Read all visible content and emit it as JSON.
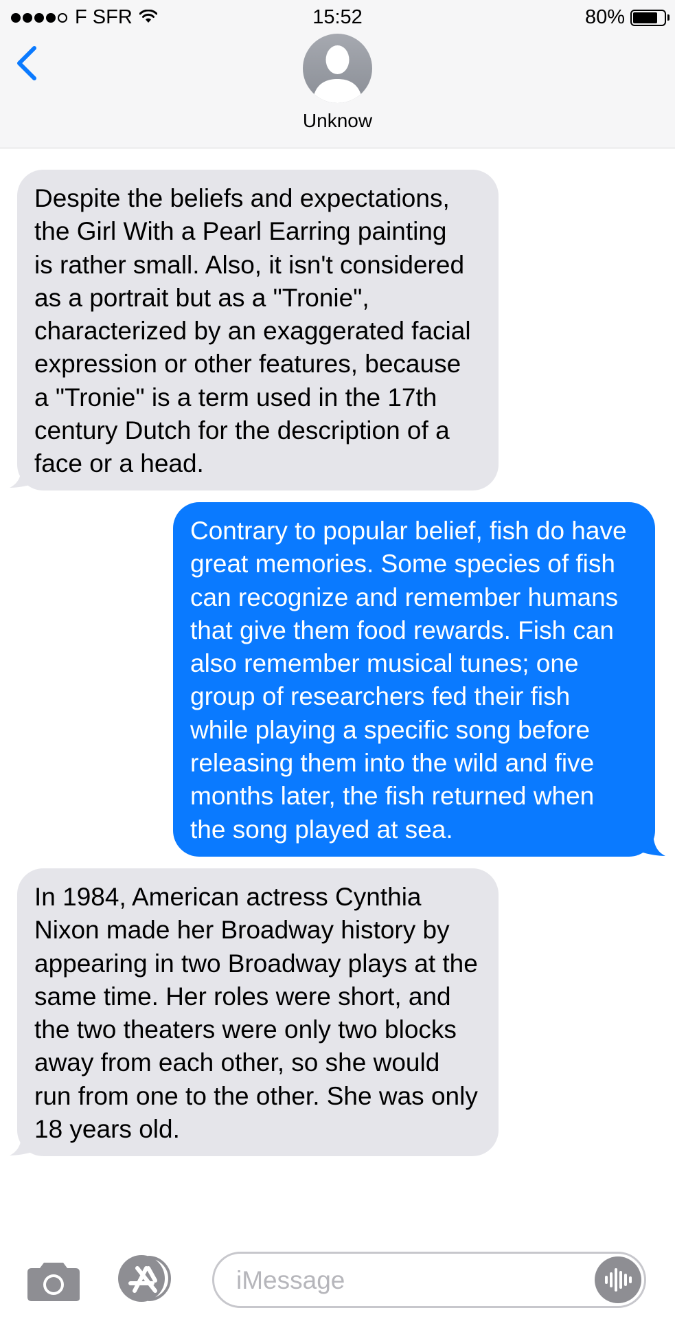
{
  "status_bar": {
    "carrier": "F SFR",
    "time": "15:52",
    "battery_percent": "80%",
    "battery_level": 0.8
  },
  "header": {
    "contact_name": "Unknow"
  },
  "messages": [
    {
      "direction": "received",
      "text": "Despite the beliefs and expectations,\nthe Girl With a Pearl Earring painting\nis rather small. Also, it isn't considered\nas a portrait but as a \"Tronie\",\ncharacterized by an exaggerated facial\nexpression or other features, because\na \"Tronie\" is a term used in the 17th\ncentury Dutch for the description of a\nface or a head."
    },
    {
      "direction": "sent",
      "text": "Contrary to popular belief, fish do have\ngreat memories. Some species of fish\ncan recognize and remember humans\nthat give them food rewards. Fish can\nalso remember musical tunes; one\ngroup of researchers fed their fish\nwhile playing a specific song before\nreleasing them into the wild and five\nmonths later, the fish returned when\nthe song played at sea."
    },
    {
      "direction": "received",
      "text": "In 1984, American actress Cynthia\nNixon made her Broadway history by\nappearing in two Broadway plays at the\nsame time. Her roles were short, and\nthe two theaters were only two blocks\naway from each other, so she would\nrun from one to the other. She was only\n18 years old."
    }
  ],
  "input_bar": {
    "placeholder": "iMessage",
    "value": ""
  },
  "colors": {
    "accent": "#0a7aff",
    "received_bubble": "#e5e5ea",
    "header_bg": "#f6f6f7"
  }
}
